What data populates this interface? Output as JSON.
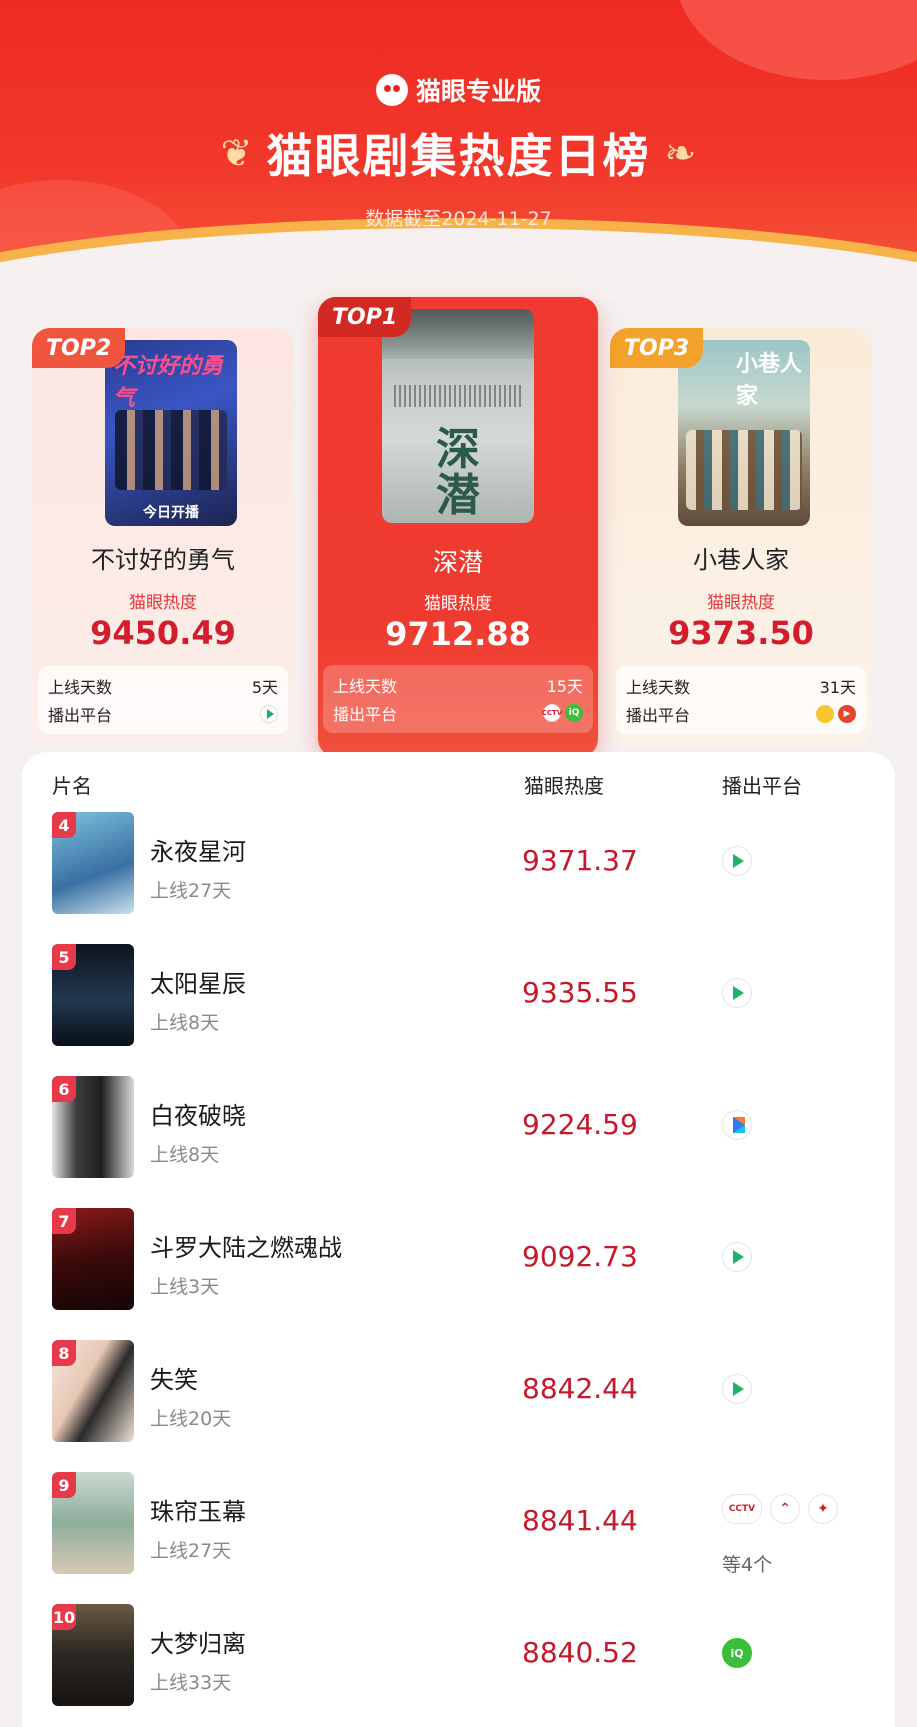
{
  "header": {
    "brand": "猫眼专业版",
    "title": "猫眼剧集热度日榜",
    "subtitle": "数据截至2024-11-27"
  },
  "labels": {
    "heat": "猫眼热度",
    "online_days": "上线天数",
    "platform": "播出平台"
  },
  "top": [
    {
      "rank_tag": "TOP2",
      "name": "不讨好的勇气",
      "heat": "9450.49",
      "days": "5天",
      "poster_text": "不讨好的勇气",
      "poster_caption": "今日开播",
      "platforms": [
        "tencent-video"
      ]
    },
    {
      "rank_tag": "TOP1",
      "name": "深潜",
      "heat": "9712.88",
      "days": "15天",
      "poster_text": "深潜",
      "platforms": [
        "cctv",
        "iqiyi"
      ]
    },
    {
      "rank_tag": "TOP3",
      "name": "小巷人家",
      "heat": "9373.50",
      "days": "31天",
      "poster_text": "小巷人家",
      "platforms": [
        "mango",
        "bilibili"
      ]
    }
  ],
  "list_header": {
    "name": "片名",
    "heat": "猫眼热度",
    "platform": "播出平台"
  },
  "list": [
    {
      "rank": "4",
      "name": "永夜星河",
      "days": "上线27天",
      "heat": "9371.37",
      "platforms": [
        "tencent-video"
      ],
      "thumb_color": "#5aa9c9"
    },
    {
      "rank": "5",
      "name": "太阳星辰",
      "days": "上线8天",
      "heat": "9335.55",
      "platforms": [
        "tencent-video"
      ],
      "thumb_color": "#1c2a3f"
    },
    {
      "rank": "6",
      "name": "白夜破晓",
      "days": "上线8天",
      "heat": "9224.59",
      "platforms": [
        "youku"
      ],
      "thumb_color": "#3a3a3a"
    },
    {
      "rank": "7",
      "name": "斗罗大陆之燃魂战",
      "days": "上线3天",
      "heat": "9092.73",
      "platforms": [
        "tencent-video"
      ],
      "thumb_color": "#5a1212"
    },
    {
      "rank": "8",
      "name": "失笑",
      "days": "上线20天",
      "heat": "8842.44",
      "platforms": [
        "tencent-video"
      ],
      "thumb_color": "#e9d3c5"
    },
    {
      "rank": "9",
      "name": "珠帘玉幕",
      "days": "上线27天",
      "heat": "8841.44",
      "platforms": [
        "cctv",
        "dragon-tv",
        "jiangsu-tv"
      ],
      "more": "等4个",
      "thumb_color": "#9fb6a8"
    },
    {
      "rank": "10",
      "name": "大梦归离",
      "days": "上线33天",
      "heat": "8840.52",
      "platforms": [
        "iqiyi"
      ],
      "thumb_color": "#2b2722"
    }
  ],
  "colors": {
    "header_red": "#ee2b22",
    "heat_red": "#c4192b",
    "rank_badge": "#e8394a",
    "top2_tag": "#f0553e",
    "top3_tag": "#f3a22b"
  }
}
